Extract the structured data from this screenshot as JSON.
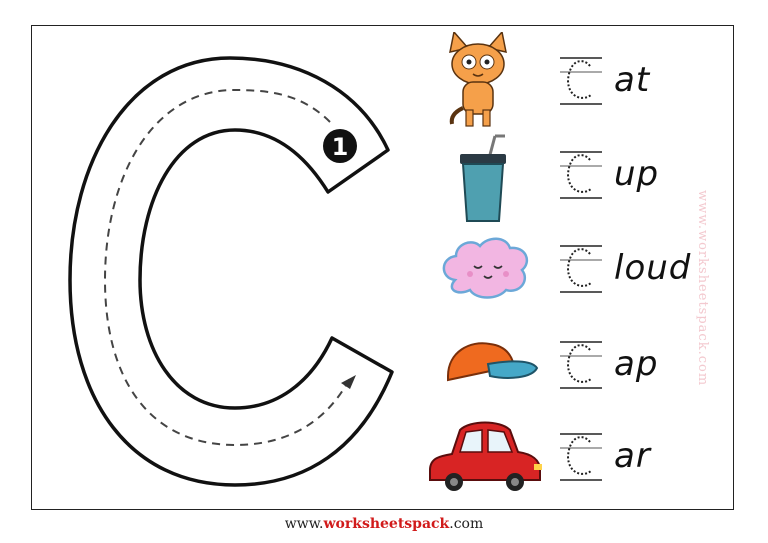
{
  "worksheet": {
    "letter": "C",
    "stroke_number": "1",
    "rows": [
      {
        "picture": "cat",
        "trace_letter": "c",
        "ending": "at"
      },
      {
        "picture": "cup",
        "trace_letter": "c",
        "ending": "up"
      },
      {
        "picture": "cloud",
        "trace_letter": "c",
        "ending": "loud"
      },
      {
        "picture": "cap",
        "trace_letter": "c",
        "ending": "ap"
      },
      {
        "picture": "car",
        "trace_letter": "c",
        "ending": "ar"
      }
    ]
  },
  "footer": {
    "prefix": "www.",
    "brand": "worksheetspack",
    "suffix": ".com"
  },
  "watermark": "www.worksheetspack.com",
  "colors": {
    "brand_red": "#d11a1a",
    "cat_orange": "#f5a04a",
    "cup_teal": "#4fa0b0",
    "cloud_pink": "#f2b6e2",
    "cap_orange": "#ef6a1f",
    "cap_blue": "#45a8c8",
    "car_red": "#d82424"
  }
}
